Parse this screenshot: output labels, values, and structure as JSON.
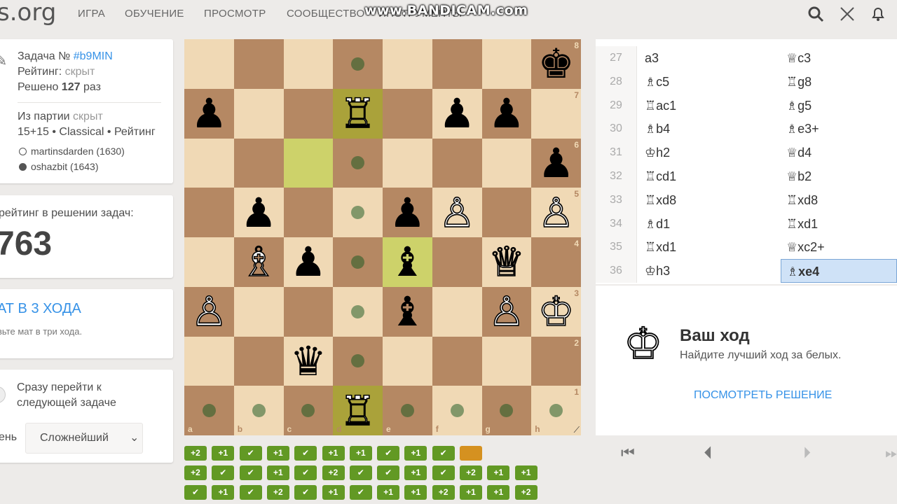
{
  "topbar": {
    "logo": "s.org",
    "nav": [
      "ИГРА",
      "ОБУЧЕНИЕ",
      "ПРОСМОТР",
      "СООБЩЕСТВО",
      "ИНСТРУМЕНТЫ"
    ],
    "watermark": "www.BANDICAM.com",
    "icons": [
      "search-icon",
      "swords-icon",
      "bell-icon"
    ]
  },
  "puzzle": {
    "title_prefix": "Задача №",
    "id": "#b9MIN",
    "rating_label": "Рейтинг:",
    "rating_value": "скрыт",
    "solved_prefix": "Решено",
    "solved_count": "127",
    "solved_suffix": "раз"
  },
  "game": {
    "from_label": "Из партии",
    "from_value": "скрыт",
    "info": "15+15 • Classical • Рейтинг",
    "white_player": "martinsdarden (1630)",
    "black_player": "oshazbit (1643)"
  },
  "user_rating": {
    "label": "рейтинг в решении задач:",
    "value": "763"
  },
  "theme": {
    "title": "АТ В 3 ХОДА",
    "desc": "вьте мат в три хода."
  },
  "settings": {
    "jump_label_1": "Сразу перейти к",
    "jump_label_2": "следующей задаче",
    "difficulty_label": "ень",
    "difficulty_value": "Сложнейший"
  },
  "board": {
    "ranks": [
      "8",
      "7",
      "6",
      "5",
      "4",
      "3",
      "2",
      "1"
    ],
    "files": [
      "a",
      "b",
      "c",
      "d",
      "e",
      "f",
      "g",
      "h"
    ],
    "rows": [
      [
        "",
        "",
        "",
        "",
        "",
        "",
        "",
        "k"
      ],
      [
        "p",
        "",
        "",
        "R",
        "",
        "p",
        "p",
        ""
      ],
      [
        "",
        "",
        "",
        "",
        "",
        "",
        "",
        "p"
      ],
      [
        "",
        "p",
        "",
        "",
        "p",
        "P",
        "",
        "P"
      ],
      [
        "",
        "B",
        "p",
        "",
        "b",
        "",
        "Q",
        ""
      ],
      [
        "P",
        "",
        "",
        "",
        "b",
        "",
        "P",
        "K"
      ],
      [
        "",
        "",
        "q",
        "",
        "",
        "",
        "",
        ""
      ],
      [
        "",
        "",
        "",
        "R",
        "",
        "",
        "",
        ""
      ]
    ],
    "dots": [
      "d8",
      "d6",
      "d5",
      "d4",
      "d3",
      "d2",
      "a1",
      "b1",
      "c1",
      "e1",
      "f1",
      "g1",
      "h1"
    ],
    "highlight_squares": [
      "c6",
      "e4"
    ],
    "selected_square": "d7",
    "ghost_piece_square": "d1"
  },
  "moves": [
    {
      "num": "27",
      "white": "a3",
      "black": "♕c3"
    },
    {
      "num": "28",
      "white": "♗c5",
      "black": "♖g8"
    },
    {
      "num": "29",
      "white": "♖ac1",
      "black": "♗g5"
    },
    {
      "num": "30",
      "white": "♗b4",
      "black": "♗e3+"
    },
    {
      "num": "31",
      "white": "♔h2",
      "black": "♕d4"
    },
    {
      "num": "32",
      "white": "♖cd1",
      "black": "♕b2"
    },
    {
      "num": "33",
      "white": "♖xd8",
      "black": "♖xd8"
    },
    {
      "num": "34",
      "white": "♗d1",
      "black": "♖xd1"
    },
    {
      "num": "35",
      "white": "♖xd1",
      "black": "♕xc2+"
    },
    {
      "num": "36",
      "white": "♔h3",
      "black": "♗xe4"
    }
  ],
  "status": {
    "title": "Ваш ход",
    "subtitle": "Найдите лучший ход за белых.",
    "solution_button": "ПОСМОТРЕТЬ РЕШЕНИЕ"
  },
  "history": [
    [
      "+2",
      "+1",
      "✔",
      "+1",
      "✔",
      "+1",
      "+1",
      "✔",
      "+1",
      "✔",
      ""
    ],
    [
      "+2",
      "✔",
      "✔",
      "+1",
      "✔",
      "+2",
      "✔",
      "✔",
      "+1",
      "✔",
      "+2",
      "+1",
      "+1"
    ],
    [
      "✔",
      "+1",
      "✔",
      "+2",
      "✔",
      "+1",
      "✔",
      "+1",
      "+1",
      "+2",
      "+1",
      "+1",
      "+2"
    ]
  ],
  "colors": {
    "light_square": "#f0d9b5",
    "dark_square": "#b58863",
    "highlight": "#cdd26a",
    "accent": "#3692e7",
    "history_green": "#629924",
    "history_current": "#d59120"
  }
}
